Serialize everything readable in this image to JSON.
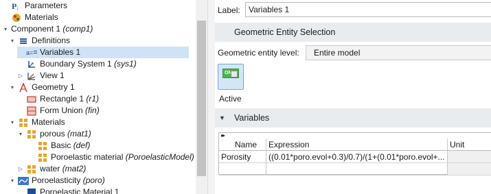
{
  "tree": {
    "items": [
      {
        "label": "Parameters",
        "tag": "",
        "icon": "parameters-icon",
        "twisty": ""
      },
      {
        "label": "Materials",
        "tag": "",
        "icon": "materials-icon",
        "twisty": ""
      },
      {
        "label": "Component 1 ",
        "tag": "(comp1)",
        "icon": "component-icon",
        "twisty": "▾"
      },
      {
        "label": "Definitions",
        "tag": "",
        "icon": "definitions-icon",
        "twisty": "▾"
      },
      {
        "label": "Variables 1",
        "tag": "",
        "icon": "variables-icon",
        "twisty": ""
      },
      {
        "label": "Boundary System 1 ",
        "tag": "(sys1)",
        "icon": "boundary-system-icon",
        "twisty": ""
      },
      {
        "label": "View 1",
        "tag": "",
        "icon": "view-icon",
        "twisty": "▷"
      },
      {
        "label": "Geometry 1",
        "tag": "",
        "icon": "geometry-icon",
        "twisty": "▾"
      },
      {
        "label": "Rectangle 1 ",
        "tag": "(r1)",
        "icon": "rectangle-icon",
        "twisty": ""
      },
      {
        "label": "Form Union ",
        "tag": "(fin)",
        "icon": "form-union-icon",
        "twisty": ""
      },
      {
        "label": "Materials",
        "tag": "",
        "icon": "materials-icon",
        "twisty": "▾"
      },
      {
        "label": "porous ",
        "tag": "(mat1)",
        "icon": "material-icon",
        "twisty": "▾"
      },
      {
        "label": "Basic ",
        "tag": "(def)",
        "icon": "property-group-icon",
        "twisty": ""
      },
      {
        "label": "Poroelastic material ",
        "tag": "(PoroelasticModel)",
        "icon": "property-group-icon",
        "twisty": ""
      },
      {
        "label": "water ",
        "tag": "(mat2)",
        "icon": "material-icon",
        "twisty": "▷"
      },
      {
        "label": "Poroelasticity ",
        "tag": "(poro)",
        "icon": "physics-icon",
        "twisty": "▾"
      },
      {
        "label": "Poroelastic Material 1",
        "tag": "",
        "icon": "physics-feature-icon",
        "twisty": ""
      }
    ]
  },
  "settings": {
    "label_caption": "Label:",
    "label_value": "Variables 1",
    "geo_section_title": "Geometric Entity Selection",
    "level_caption": "Geometric entity level:",
    "level_value": "Entire model",
    "active_toggle_text": "ON",
    "active_label": "Active",
    "vars_section_title": "Variables",
    "vars_section_arrow": "▼"
  },
  "table": {
    "collapse_glyph": "▸▸",
    "headers": {
      "name": "Name",
      "expression": "Expression",
      "unit": "Unit"
    },
    "rows": [
      {
        "name": "Porosity",
        "expression": "((0.01*poro.evol+0.3)/0.7)/(1+(0.01*poro.evol+...",
        "unit": ""
      },
      {
        "name": "",
        "expression": "",
        "unit": ""
      }
    ]
  },
  "colors": {
    "selected_row": "#cfe3f6",
    "section_bar": "#e9ecef",
    "active_button": "#d3e6f7",
    "toggle_on": "#4db34d"
  }
}
